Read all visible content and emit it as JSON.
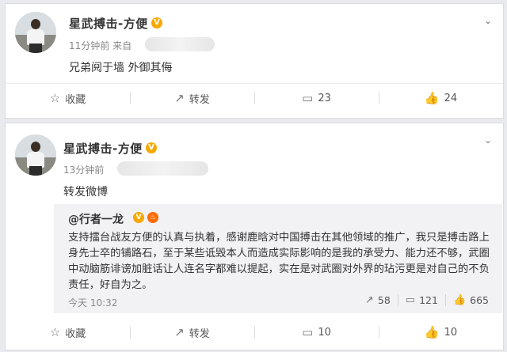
{
  "post1": {
    "author": "星武搏击-方便",
    "verified_badge": "V",
    "time": "11分钟前 来自",
    "text": "兄弟阋于墙   外御其侮",
    "actions": {
      "favorite": "收藏",
      "forward": "转发",
      "comments": "23",
      "likes": "24"
    }
  },
  "post2": {
    "author": "星武搏击-方便",
    "verified_badge": "V",
    "time": "13分钟前",
    "text": "转发微博",
    "repost": {
      "author": "@行者一龙",
      "badge_v": "V",
      "badge_fire": "♨",
      "body": "支持擂台战友方便的认真与执着，感谢鹿晗对中国搏击在其他领域的推广，我只是搏击路上身先士卒的铺路石，至于某些诋毁本人而造成实际影响的是我的承受力、能力还不够，武圈中动脑筋诽谤加脏话让人连名字都难以提起，实在是对武圈对外界的玷污更是对自己的不负责任，好自为之。",
      "time": "今天 10:32",
      "forwards": "58",
      "comments": "121",
      "likes": "665"
    },
    "actions": {
      "favorite": "收藏",
      "forward": "转发",
      "comments": "10",
      "likes": "10"
    }
  },
  "icons": {
    "star": "☆",
    "forward": "↗",
    "comment": "▭",
    "like": "👍",
    "caret": "⌄"
  },
  "colors": {
    "verified": "#f6a800",
    "background": "#e9eaee"
  }
}
